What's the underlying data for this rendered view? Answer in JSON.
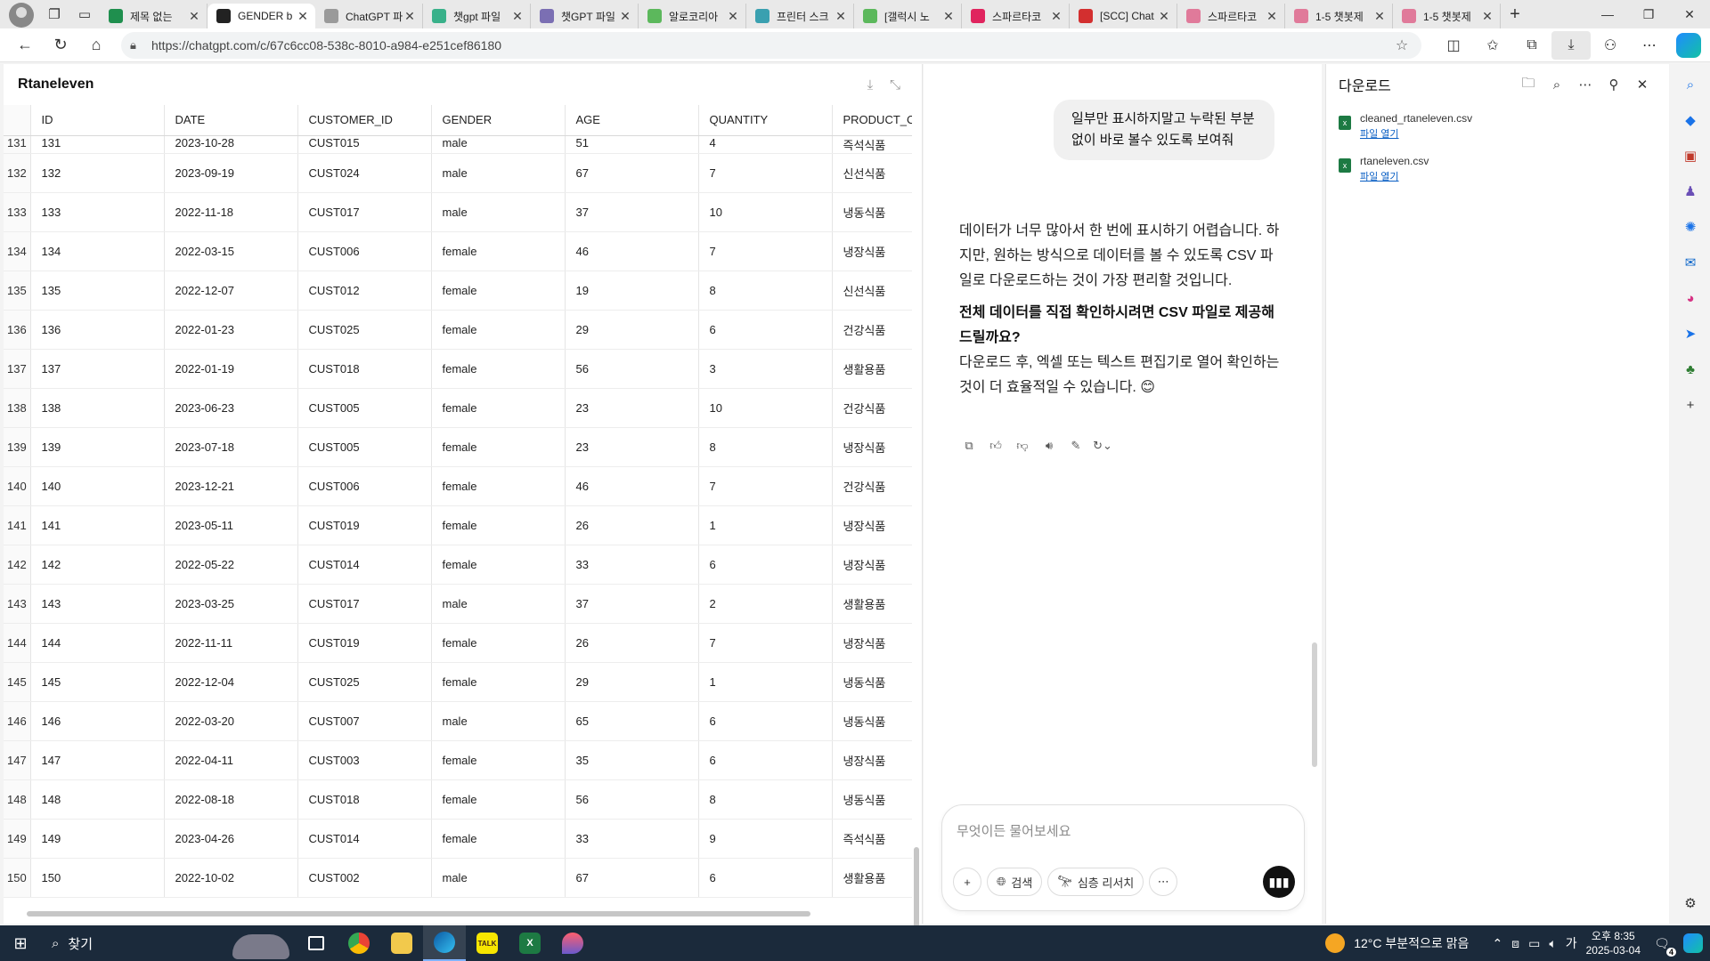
{
  "browser": {
    "tabs": [
      {
        "label": "제목 없는",
        "color": "#1f8f4e"
      },
      {
        "label": "GENDER b",
        "color": "#222222",
        "active": true
      },
      {
        "label": "ChatGPT 파",
        "color": "#9a9a9a"
      },
      {
        "label": "챗gpt 파일",
        "color": "#39b18a"
      },
      {
        "label": "챗GPT 파일",
        "color": "#7b6fb3"
      },
      {
        "label": "알로코리아",
        "color": "#5cb85c"
      },
      {
        "label": "프린터 스크",
        "color": "#3aa0b0"
      },
      {
        "label": "[갤럭시 노",
        "color": "#5cb85c"
      },
      {
        "label": "스파르타코",
        "color": "#e0245e"
      },
      {
        "label": "[SCC] Chat",
        "color": "#d32f2f"
      },
      {
        "label": "스파르타코",
        "color": "#e07a9a"
      },
      {
        "label": "1-5 챗봇제",
        "color": "#e07a9a"
      },
      {
        "label": "1-5 챗봇제",
        "color": "#e07a9a"
      }
    ],
    "url": "https://chatgpt.com/c/67c6cc08-538c-8010-a984-e251cef86180"
  },
  "data_panel": {
    "title": "Rtaneleven",
    "columns": [
      "ID",
      "DATE",
      "CUSTOMER_ID",
      "GENDER",
      "AGE",
      "QUANTITY",
      "PRODUCT_C"
    ],
    "partial_row": {
      "index": "131",
      "cells": [
        "131",
        "2023-10-28",
        "CUST015",
        "male",
        "51",
        "4",
        "즉석식품"
      ]
    },
    "rows": [
      {
        "index": "132",
        "cells": [
          "132",
          "2023-09-19",
          "CUST024",
          "male",
          "67",
          "7",
          "신선식품"
        ]
      },
      {
        "index": "133",
        "cells": [
          "133",
          "2022-11-18",
          "CUST017",
          "male",
          "37",
          "10",
          "냉동식품"
        ]
      },
      {
        "index": "134",
        "cells": [
          "134",
          "2022-03-15",
          "CUST006",
          "female",
          "46",
          "7",
          "냉장식품"
        ]
      },
      {
        "index": "135",
        "cells": [
          "135",
          "2022-12-07",
          "CUST012",
          "female",
          "19",
          "8",
          "신선식품"
        ]
      },
      {
        "index": "136",
        "cells": [
          "136",
          "2022-01-23",
          "CUST025",
          "female",
          "29",
          "6",
          "건강식품"
        ]
      },
      {
        "index": "137",
        "cells": [
          "137",
          "2022-01-19",
          "CUST018",
          "female",
          "56",
          "3",
          "생활용품"
        ]
      },
      {
        "index": "138",
        "cells": [
          "138",
          "2023-06-23",
          "CUST005",
          "female",
          "23",
          "10",
          "건강식품"
        ]
      },
      {
        "index": "139",
        "cells": [
          "139",
          "2023-07-18",
          "CUST005",
          "female",
          "23",
          "8",
          "냉장식품"
        ]
      },
      {
        "index": "140",
        "cells": [
          "140",
          "2023-12-21",
          "CUST006",
          "female",
          "46",
          "7",
          "건강식품"
        ]
      },
      {
        "index": "141",
        "cells": [
          "141",
          "2023-05-11",
          "CUST019",
          "female",
          "26",
          "1",
          "냉장식품"
        ]
      },
      {
        "index": "142",
        "cells": [
          "142",
          "2022-05-22",
          "CUST014",
          "female",
          "33",
          "6",
          "냉장식품"
        ]
      },
      {
        "index": "143",
        "cells": [
          "143",
          "2023-03-25",
          "CUST017",
          "male",
          "37",
          "2",
          "생활용품"
        ]
      },
      {
        "index": "144",
        "cells": [
          "144",
          "2022-11-11",
          "CUST019",
          "female",
          "26",
          "7",
          "냉장식품"
        ]
      },
      {
        "index": "145",
        "cells": [
          "145",
          "2022-12-04",
          "CUST025",
          "female",
          "29",
          "1",
          "냉동식품"
        ]
      },
      {
        "index": "146",
        "cells": [
          "146",
          "2022-03-20",
          "CUST007",
          "male",
          "65",
          "6",
          "냉동식품"
        ]
      },
      {
        "index": "147",
        "cells": [
          "147",
          "2022-04-11",
          "CUST003",
          "female",
          "35",
          "6",
          "냉장식품"
        ]
      },
      {
        "index": "148",
        "cells": [
          "148",
          "2022-08-18",
          "CUST018",
          "female",
          "56",
          "8",
          "냉동식품"
        ]
      },
      {
        "index": "149",
        "cells": [
          "149",
          "2023-04-26",
          "CUST014",
          "female",
          "33",
          "9",
          "즉석식품"
        ]
      },
      {
        "index": "150",
        "cells": [
          "150",
          "2022-10-02",
          "CUST002",
          "male",
          "67",
          "6",
          "생활용품"
        ]
      }
    ]
  },
  "chat": {
    "user_message": "일부만 표시하지말고 누락된 부분 없이 바로 볼수 있도록 보여줘",
    "assistant_p1": "데이터가 너무 많아서 한 번에 표시하기 어렵습니다. 하지만, 원하는 방식으로 데이터를 볼 수 있도록 CSV 파일로 다운로드하는 것이 가장 편리할 것입니다.",
    "assistant_bold": "전체 데이터를 직접 확인하시려면 CSV 파일로 제공해 드릴까요?",
    "assistant_p2": "다운로드 후, 엑셀 또는 텍스트 편집기로 열어 확인하는 것이 더 효율적일 수 있습니다. 😊",
    "composer_placeholder": "무엇이든 물어보세요",
    "search_label": "검색",
    "deep_research_label": "심층 리서치"
  },
  "downloads": {
    "title": "다운로드",
    "items": [
      {
        "name": "cleaned_rtaneleven.csv",
        "action": "파일 열기"
      },
      {
        "name": "rtaneleven.csv",
        "action": "파일 열기"
      }
    ]
  },
  "taskbar": {
    "search_label": "찾기",
    "weather": "12°C 부분적으로 맑음",
    "ime": "가",
    "time": "오후 8:35",
    "date": "2025-03-04",
    "notification_count": "4"
  }
}
